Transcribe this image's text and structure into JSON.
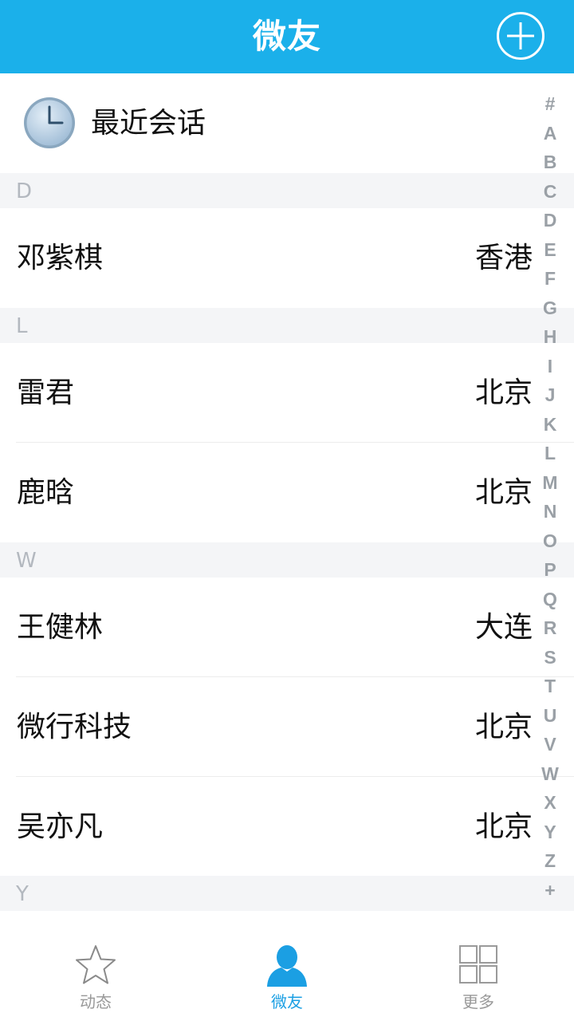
{
  "header": {
    "title": "微友",
    "add_icon": "plus-circle-icon"
  },
  "recent": {
    "icon": "clock-icon",
    "label": "最近会话"
  },
  "sections": [
    {
      "letter": "D",
      "contacts": [
        {
          "name": "邓紫棋",
          "city": "香港"
        }
      ]
    },
    {
      "letter": "L",
      "contacts": [
        {
          "name": "雷君",
          "city": "北京"
        },
        {
          "name": "鹿晗",
          "city": "北京"
        }
      ]
    },
    {
      "letter": "W",
      "contacts": [
        {
          "name": "王健林",
          "city": "大连"
        },
        {
          "name": "微行科技",
          "city": "北京"
        },
        {
          "name": "吴亦凡",
          "city": "北京"
        }
      ]
    },
    {
      "letter": "Y",
      "contacts": []
    }
  ],
  "index_letters": [
    "#",
    "A",
    "B",
    "C",
    "D",
    "E",
    "F",
    "G",
    "H",
    "I",
    "J",
    "K",
    "L",
    "M",
    "N",
    "O",
    "P",
    "Q",
    "R",
    "S",
    "T",
    "U",
    "V",
    "W",
    "X",
    "Y",
    "Z",
    "+"
  ],
  "tabs": [
    {
      "label": "动态",
      "icon": "star-icon",
      "active": false
    },
    {
      "label": "微友",
      "icon": "person-icon",
      "active": true
    },
    {
      "label": "更多",
      "icon": "grid-icon",
      "active": false
    }
  ],
  "colors": {
    "header_bg": "#1bb0ea",
    "active_tab": "#1b9fe3",
    "inactive_tab": "#999999",
    "section_bg": "#f4f5f7"
  }
}
